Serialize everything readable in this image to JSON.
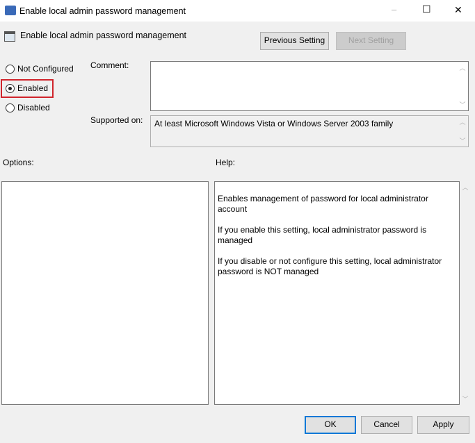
{
  "window": {
    "title": "Enable local admin password management",
    "minimize": "–",
    "maximize": "☐",
    "close": "✕"
  },
  "header": {
    "setting_name": "Enable local admin password management",
    "previous_label": "Previous Setting",
    "next_label": "Next Setting"
  },
  "state": {
    "options": [
      "Not Configured",
      "Enabled",
      "Disabled"
    ],
    "selected": "Enabled"
  },
  "comment": {
    "label": "Comment:",
    "value": ""
  },
  "supported": {
    "label": "Supported on:",
    "value": "At least Microsoft Windows Vista or Windows Server 2003 family"
  },
  "options_label": "Options:",
  "help": {
    "label": "Help:",
    "paragraphs": [
      "Enables management of password for local administrator account",
      "If you enable this setting, local administrator password is managed",
      "If you disable or not configure this setting, local administrator password is NOT managed"
    ]
  },
  "buttons": {
    "ok": "OK",
    "cancel": "Cancel",
    "apply": "Apply"
  },
  "colors": {
    "highlight": "#d0242b",
    "accent": "#0078d7"
  }
}
